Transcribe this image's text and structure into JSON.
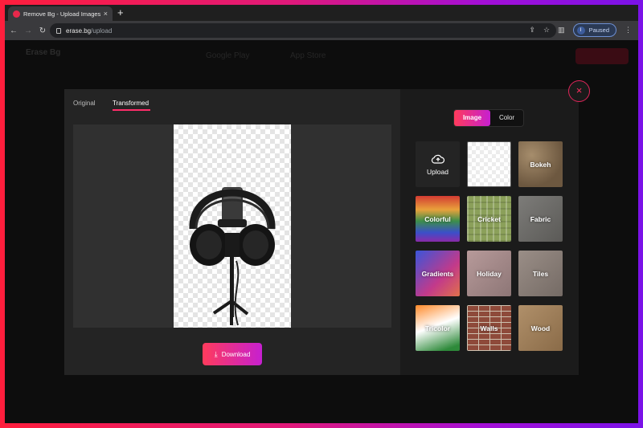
{
  "browser": {
    "tab_title": "Remove Bg - Upload Images to",
    "tab_close": "×",
    "new_tab": "+",
    "url_host": "erase.bg",
    "url_path": "/upload",
    "profile_initial": "I",
    "profile_status": "Paused"
  },
  "site_header": {
    "logo_line1": "Erase Bg",
    "store_google": "Google Play",
    "store_apple": "App Store"
  },
  "modal": {
    "close_label": "×",
    "view_tabs": {
      "original": "Original",
      "transformed": "Transformed"
    },
    "download_label": "Download",
    "bg_mode": {
      "image": "Image",
      "color": "Color"
    },
    "bg_tiles": {
      "upload": "Upload",
      "bokeh": "Bokeh",
      "colorful": "Colorful",
      "cricket": "Cricket",
      "fabric": "Fabric",
      "gradients": "Gradients",
      "holiday": "Holiday",
      "tiles": "Tiles",
      "tricolor": "Tricolor",
      "walls": "Walls",
      "wood": "Wood"
    }
  },
  "colors": {
    "accent_start": "#ff3b5c",
    "accent_end": "#c620d0",
    "close_ring": "#e0255a"
  }
}
